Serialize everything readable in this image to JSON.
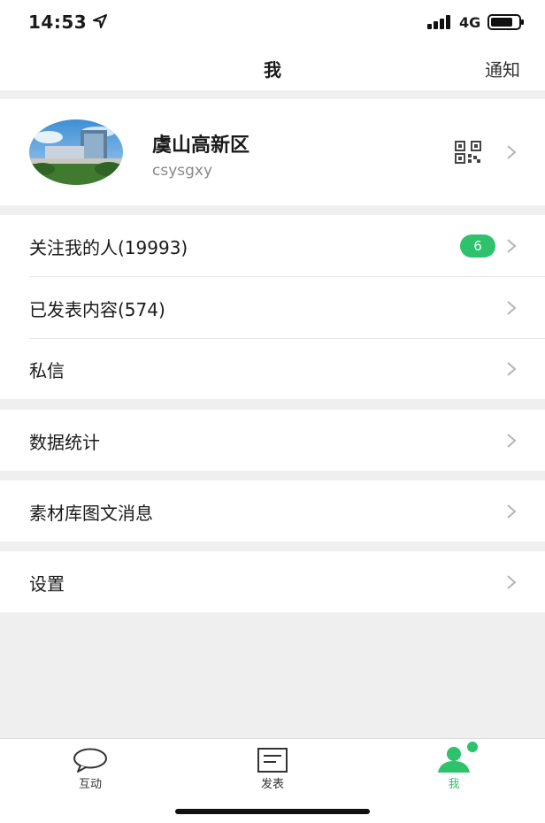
{
  "status_bar": {
    "time": "14:53",
    "network": "4G"
  },
  "nav": {
    "title": "我",
    "right_action": "通知"
  },
  "profile": {
    "name": "虞山高新区",
    "account_id": "csysgxy"
  },
  "menu": {
    "followers": {
      "label": "关注我的人(19993)",
      "badge": "6"
    },
    "published": {
      "label": "已发表内容(574)"
    },
    "messages": {
      "label": "私信"
    },
    "statistics": {
      "label": "数据统计"
    },
    "materials": {
      "label": "素材库图文消息"
    },
    "settings": {
      "label": "设置"
    }
  },
  "tabs": [
    {
      "label": "互动",
      "icon": "chat-bubble-icon"
    },
    {
      "label": "发表",
      "icon": "compose-icon"
    },
    {
      "label": "我",
      "icon": "person-icon",
      "active": true
    }
  ],
  "colors": {
    "accent": "#2dc26b",
    "background": "#efefef",
    "card": "#ffffff"
  }
}
